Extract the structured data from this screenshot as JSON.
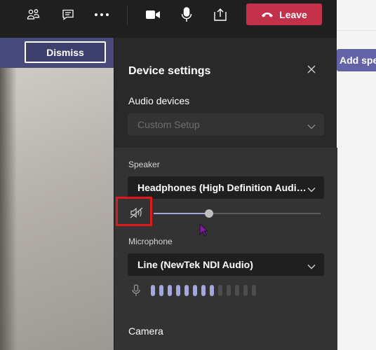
{
  "toolbar": {
    "icons": [
      "participants-icon",
      "chat-icon",
      "more-options-icon",
      "camera-icon",
      "microphone-icon",
      "share-screen-icon"
    ],
    "leave_label": "Leave",
    "leave_color": "#c4314b"
  },
  "banner": {
    "dismiss_label": "Dismiss"
  },
  "side": {
    "add_speaker_label": "Add spe"
  },
  "panel": {
    "title": "Device settings",
    "audio_devices_label": "Audio devices",
    "audio_device_value": "Custom Setup",
    "speaker_label": "Speaker",
    "speaker_value": "Headphones (High Definition Audio Device)",
    "speaker_volume": 0.33,
    "microphone_label": "Microphone",
    "microphone_value": "Line (NewTek NDI Audio)",
    "mic_level_active": 8,
    "mic_level_total": 13,
    "camera_label": "Camera"
  },
  "colors": {
    "accent": "#6264a7",
    "mic_active": "#a6a7dc",
    "mic_inactive": "#4d4d4d"
  }
}
